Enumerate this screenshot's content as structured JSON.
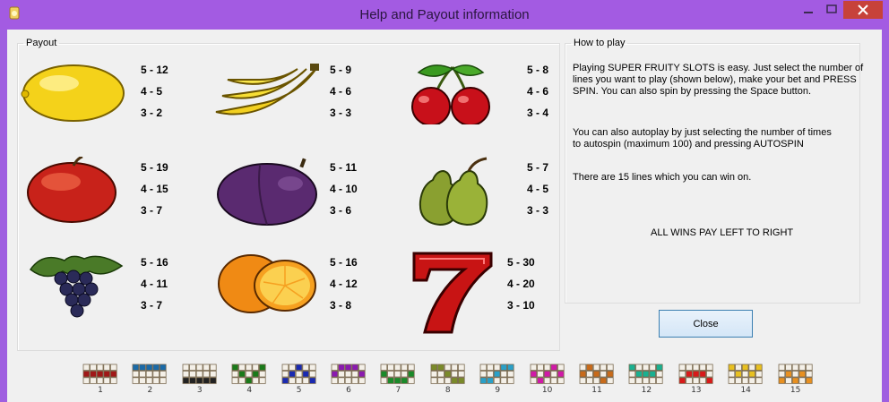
{
  "window": {
    "title": "Help and Payout information",
    "app_icon": "app-icon"
  },
  "payout": {
    "legend": "Payout",
    "symbols": [
      {
        "name": "lemon",
        "pays": [
          "5 - 12",
          "4 - 5",
          "3 - 2"
        ]
      },
      {
        "name": "banana",
        "pays": [
          "5 - 9",
          "4 - 6",
          "3 - 3"
        ]
      },
      {
        "name": "cherry",
        "pays": [
          "5 - 8",
          "4 - 6",
          "3 - 4"
        ]
      },
      {
        "name": "apple",
        "pays": [
          "5 - 19",
          "4 - 15",
          "3 - 7"
        ]
      },
      {
        "name": "plum",
        "pays": [
          "5 - 11",
          "4 - 10",
          "3 - 6"
        ]
      },
      {
        "name": "pear",
        "pays": [
          "5 - 7",
          "4 - 5",
          "3 - 3"
        ]
      },
      {
        "name": "grapes",
        "pays": [
          "5 - 16",
          "4 - 11",
          "3 - 7"
        ]
      },
      {
        "name": "orange",
        "pays": [
          "5 - 16",
          "4 - 12",
          "3 - 8"
        ]
      },
      {
        "name": "seven",
        "pays": [
          "5 - 30",
          "4 - 20",
          "3 - 10"
        ]
      }
    ]
  },
  "howto": {
    "legend": "How to play",
    "para1": [
      "Playing SUPER FRUITY SLOTS is easy. Just select the number of",
      "lines you want to play (shown below), make your bet and PRESS",
      "SPIN. You can also spin by pressing the Space button."
    ],
    "para2": [
      "You can also autoplay by just selecting the number of times",
      "to autospin (maximum 100) and pressing AUTOSPIN"
    ],
    "para3": "There are 15 lines which you can win on.",
    "para4": "ALL WINS PAY LEFT TO RIGHT"
  },
  "close_label": "Close",
  "lines": [
    {
      "num": "1",
      "color": "#a01818"
    },
    {
      "num": "2",
      "color": "#1a6aa8"
    },
    {
      "num": "3",
      "color": "#222222"
    },
    {
      "num": "4",
      "color": "#1a7a1a"
    },
    {
      "num": "5",
      "color": "#1a2ab0"
    },
    {
      "num": "6",
      "color": "#8a1ab0"
    },
    {
      "num": "7",
      "color": "#1a8a2a"
    },
    {
      "num": "8",
      "color": "#7a8a2a"
    },
    {
      "num": "9",
      "color": "#2aa0c8"
    },
    {
      "num": "10",
      "color": "#d01aa8"
    },
    {
      "num": "11",
      "color": "#c86a1a"
    },
    {
      "num": "12",
      "color": "#1ab090"
    },
    {
      "num": "13",
      "color": "#d81a1a"
    },
    {
      "num": "14",
      "color": "#e8c020"
    },
    {
      "num": "15",
      "color": "#e89020"
    }
  ]
}
